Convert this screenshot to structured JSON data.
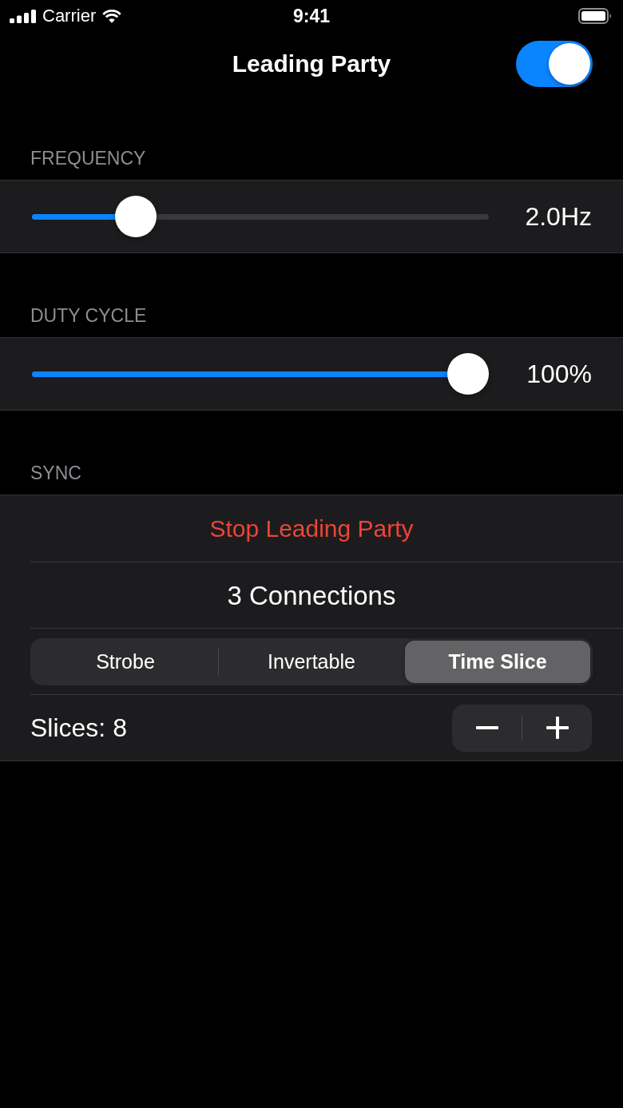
{
  "status_bar": {
    "carrier": "Carrier",
    "time": "9:41"
  },
  "nav_bar": {
    "title": "Leading Party",
    "switch": {
      "on": true
    }
  },
  "sections": [
    {
      "header": "FREQUENCY",
      "rows": [
        {
          "kind": "slider",
          "level": 0.2,
          "reading": "2.0Hz"
        }
      ]
    },
    {
      "header": "DUTY CYCLE",
      "rows": [
        {
          "kind": "slider",
          "level": 1,
          "reading": "100%"
        }
      ]
    },
    {
      "header": "SYNC",
      "rows": [
        {
          "kind": "destructive",
          "label": "Stop Leading Party"
        },
        {
          "kind": "text",
          "label": "3 Connections"
        },
        {
          "kind": "segmented",
          "segments": [
            {
              "label": "Strobe",
              "selected": false
            },
            {
              "label": "Invertable",
              "selected": false
            },
            {
              "label": "Time Slice",
              "selected": true
            }
          ]
        },
        {
          "kind": "stepper",
          "label": "Slices: 8"
        }
      ]
    }
  ]
}
